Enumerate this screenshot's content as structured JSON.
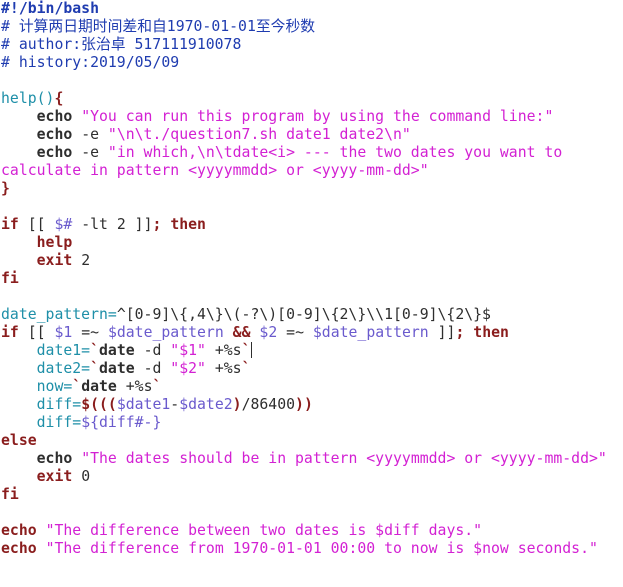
{
  "editor": {
    "lines": [
      [
        {
          "t": "#!/bin/bash",
          "c": "cmt-bold"
        }
      ],
      [
        {
          "t": "# 计算两日期时间差和自1970-01-01至今秒数",
          "c": "cm"
        }
      ],
      [
        {
          "t": "# author:张治卓 517111910078",
          "c": "cm"
        }
      ],
      [
        {
          "t": "# history:2019/05/09",
          "c": "cm"
        }
      ],
      [],
      [
        {
          "t": "help()",
          "c": "fn"
        },
        {
          "t": "{",
          "c": "kw"
        }
      ],
      [
        {
          "t": "    "
        },
        {
          "t": "echo",
          "c": "bold"
        },
        {
          "t": " "
        },
        {
          "t": "\"You can run this program by using the command line:\"",
          "c": "str"
        }
      ],
      [
        {
          "t": "    "
        },
        {
          "t": "echo",
          "c": "bold"
        },
        {
          "t": " -e "
        },
        {
          "t": "\"\\n\\t./question7.sh date1 date2\\n\"",
          "c": "str"
        }
      ],
      [
        {
          "t": "    "
        },
        {
          "t": "echo",
          "c": "bold"
        },
        {
          "t": " -e "
        },
        {
          "t": "\"in which,\\n\\tdate<i> --- the two dates you want to",
          "c": "str"
        }
      ],
      [
        {
          "t": "calculate in pattern <yyyymmdd> or <yyyy-mm-dd>\"",
          "c": "str"
        }
      ],
      [
        {
          "t": "}",
          "c": "kw"
        }
      ],
      [],
      [
        {
          "t": "if",
          "c": "kw"
        },
        {
          "t": " [[ "
        },
        {
          "t": "$#",
          "c": "var"
        },
        {
          "t": " -lt 2 ]]"
        },
        {
          "t": ";",
          "c": "kw"
        },
        {
          "t": " "
        },
        {
          "t": "then",
          "c": "kw"
        }
      ],
      [
        {
          "t": "    "
        },
        {
          "t": "help",
          "c": "kw"
        }
      ],
      [
        {
          "t": "    "
        },
        {
          "t": "exit",
          "c": "kw"
        },
        {
          "t": " 2"
        }
      ],
      [
        {
          "t": "fi",
          "c": "kw"
        }
      ],
      [],
      [
        {
          "t": "date_pattern=",
          "c": "fn"
        },
        {
          "t": "^[0-9]\\{,4\\}\\(-?\\)[0-9]\\{2\\}\\\\1[0-9]\\{2\\}$"
        }
      ],
      [
        {
          "t": "if",
          "c": "kw"
        },
        {
          "t": " [[ "
        },
        {
          "t": "$1",
          "c": "var"
        },
        {
          "t": " =~ "
        },
        {
          "t": "$date_pattern",
          "c": "var"
        },
        {
          "t": " "
        },
        {
          "t": "&&",
          "c": "kw"
        },
        {
          "t": " "
        },
        {
          "t": "$2",
          "c": "var"
        },
        {
          "t": " =~ "
        },
        {
          "t": "$date_pattern",
          "c": "var"
        },
        {
          "t": " ]]"
        },
        {
          "t": ";",
          "c": "kw"
        },
        {
          "t": " "
        },
        {
          "t": "then",
          "c": "kw"
        }
      ],
      [
        {
          "t": "    "
        },
        {
          "t": "date1=",
          "c": "fn"
        },
        {
          "t": "`",
          "c": "kw"
        },
        {
          "t": "date",
          "c": "bold"
        },
        {
          "t": " -d "
        },
        {
          "t": "\"$1\"",
          "c": "str"
        },
        {
          "t": " +%s"
        },
        {
          "t": "`",
          "c": "kw"
        },
        {
          "t": "",
          "c": "cursor"
        }
      ],
      [
        {
          "t": "    "
        },
        {
          "t": "date2=",
          "c": "fn"
        },
        {
          "t": "`",
          "c": "kw"
        },
        {
          "t": "date",
          "c": "bold"
        },
        {
          "t": " -d "
        },
        {
          "t": "\"$2\"",
          "c": "str"
        },
        {
          "t": " +%s"
        },
        {
          "t": "`",
          "c": "kw"
        }
      ],
      [
        {
          "t": "    "
        },
        {
          "t": "now=",
          "c": "fn"
        },
        {
          "t": "`",
          "c": "kw"
        },
        {
          "t": "date",
          "c": "bold"
        },
        {
          "t": " +%s"
        },
        {
          "t": "`",
          "c": "kw"
        }
      ],
      [
        {
          "t": "    "
        },
        {
          "t": "diff=",
          "c": "fn"
        },
        {
          "t": "$(((",
          "c": "kw"
        },
        {
          "t": "$date1",
          "c": "var"
        },
        {
          "t": "-"
        },
        {
          "t": "$date2",
          "c": "var"
        },
        {
          "t": ")",
          "c": "kw"
        },
        {
          "t": "/86400"
        },
        {
          "t": "))",
          "c": "kw"
        }
      ],
      [
        {
          "t": "    "
        },
        {
          "t": "diff=",
          "c": "fn"
        },
        {
          "t": "${diff#-}",
          "c": "var"
        }
      ],
      [
        {
          "t": "else",
          "c": "kw"
        }
      ],
      [
        {
          "t": "    "
        },
        {
          "t": "echo",
          "c": "bold"
        },
        {
          "t": " "
        },
        {
          "t": "\"The dates should be in pattern <yyyymmdd> or <yyyy-mm-dd>\"",
          "c": "str"
        }
      ],
      [
        {
          "t": "    "
        },
        {
          "t": "exit",
          "c": "kw"
        },
        {
          "t": " 0"
        }
      ],
      [
        {
          "t": "fi",
          "c": "kw"
        }
      ],
      [],
      [
        {
          "t": "echo",
          "c": "kw"
        },
        {
          "t": " "
        },
        {
          "t": "\"The difference between two dates is $diff days.\"",
          "c": "str"
        }
      ],
      [
        {
          "t": "echo",
          "c": "kw"
        },
        {
          "t": " "
        },
        {
          "t": "\"The difference from 1970-01-01 00:00 to now is $now seconds.\"",
          "c": "str"
        }
      ]
    ]
  }
}
